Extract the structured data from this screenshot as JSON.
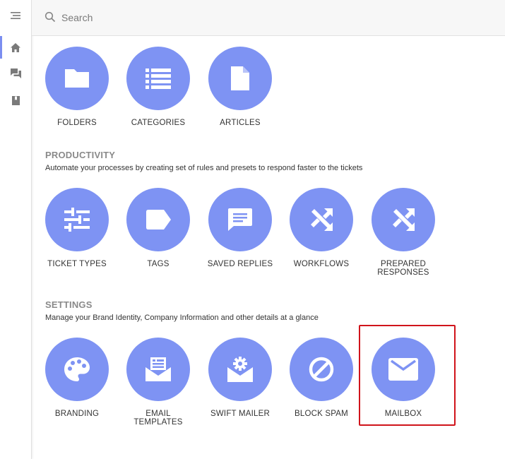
{
  "search": {
    "placeholder": "Search"
  },
  "sidebar": {
    "items": [
      {
        "icon": "menu-icon"
      },
      {
        "icon": "home-icon"
      },
      {
        "icon": "chat-icon"
      },
      {
        "icon": "book-icon"
      }
    ]
  },
  "knowledgebase": {
    "tiles": [
      {
        "label": "FOLDERS",
        "icon": "folder-icon"
      },
      {
        "label": "CATEGORIES",
        "icon": "list-icon"
      },
      {
        "label": "ARTICLES",
        "icon": "document-icon"
      }
    ]
  },
  "productivity": {
    "title": "PRODUCTIVITY",
    "description": "Automate your processes by creating set of rules and presets to respond faster to the tickets",
    "tiles": [
      {
        "label": "TICKET TYPES",
        "icon": "sliders-icon"
      },
      {
        "label": "TAGS",
        "icon": "tag-icon"
      },
      {
        "label": "SAVED REPLIES",
        "icon": "message-icon"
      },
      {
        "label": "WORKFLOWS",
        "icon": "shuffle-icon"
      },
      {
        "label": "PREPARED RESPONSES",
        "icon": "shuffle-icon"
      }
    ]
  },
  "settings": {
    "title": "SETTINGS",
    "description": "Manage your Brand Identity, Company Information and other details at a glance",
    "tiles": [
      {
        "label": "BRANDING",
        "icon": "palette-icon"
      },
      {
        "label": "EMAIL TEMPLATES",
        "icon": "email-template-icon"
      },
      {
        "label": "SWIFT MAILER",
        "icon": "mail-gear-icon"
      },
      {
        "label": "BLOCK SPAM",
        "icon": "block-icon"
      },
      {
        "label": "MAILBOX",
        "icon": "envelope-icon"
      }
    ]
  },
  "colors": {
    "tile_circle": "#7e93f3",
    "highlight": "#d0141b",
    "section_title": "#8a8a8a"
  }
}
